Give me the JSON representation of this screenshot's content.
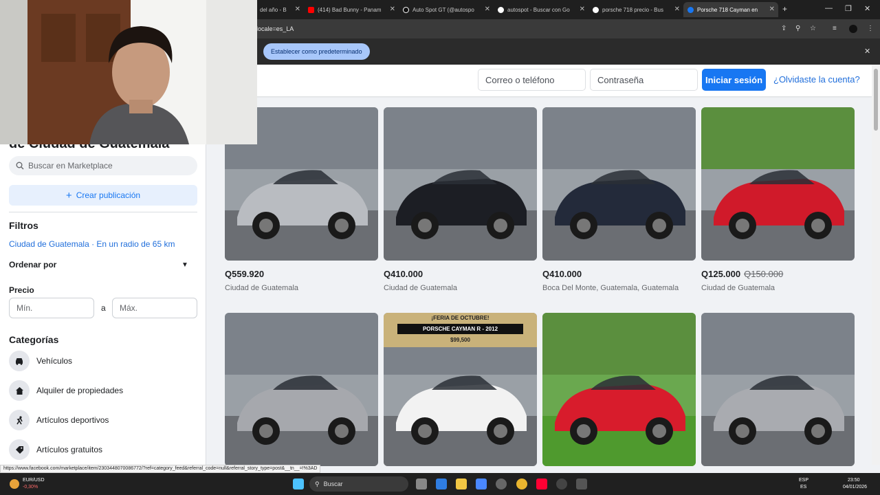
{
  "browser": {
    "tabs": [
      {
        "title": "del año - B"
      },
      {
        "title": "(414) Bad Bunny - Panam"
      },
      {
        "title": "Auto Spot GT (@autospo"
      },
      {
        "title": "autospot - Buscar con Go"
      },
      {
        "title": "porsche 718 precio - Bus"
      },
      {
        "title": "Porsche 718 Cayman en"
      }
    ],
    "url": "locale=es_LA",
    "default_button": "Establecer como predeterminado"
  },
  "login": {
    "email_placeholder": "Correo o teléfono",
    "password_placeholder": "Contraseña",
    "login_button": "Iniciar sesión",
    "forgot_link": "¿Olvidaste la cuenta?"
  },
  "sidebar": {
    "title": "de Ciudad de Guatemala",
    "search_placeholder": "Buscar en Marketplace",
    "create_label": "Crear publicación",
    "filters_label": "Filtros",
    "location": "Ciudad de Guatemala · En un radio de 65 km",
    "sort_label": "Ordenar por",
    "price_label": "Precio",
    "min_placeholder": "Mín.",
    "max_placeholder": "Máx.",
    "price_sep": "a",
    "categories_label": "Categorías",
    "categories": [
      {
        "label": "Vehículos",
        "icon": "car-icon"
      },
      {
        "label": "Alquiler de propiedades",
        "icon": "house-icon"
      },
      {
        "label": "Artículos deportivos",
        "icon": "sport-icon"
      },
      {
        "label": "Artículos gratuitos",
        "icon": "tag-icon"
      }
    ]
  },
  "listings": [
    {
      "price": "Q559.920",
      "old_price": "",
      "location": "Ciudad de Guatemala",
      "car_color": "#b9bcc1"
    },
    {
      "price": "Q410.000",
      "old_price": "",
      "location": "Ciudad de Guatemala",
      "car_color": "#1c1e24"
    },
    {
      "price": "Q410.000",
      "old_price": "",
      "location": "Boca Del Monte, Guatemala, Guatemala",
      "car_color": "#232a3a"
    },
    {
      "price": "Q125.000",
      "old_price": "Q150.000",
      "location": "Ciudad de Guatemala",
      "car_color": "#d01a2a"
    },
    {
      "car_color": "#a6a8ad"
    },
    {
      "car_color": "#f2f2f2",
      "banner": "¡FERIA DE OCTUBRE!",
      "banner2": "PORSCHE CAYMAN R - 2012",
      "banner3": "$99,500"
    },
    {
      "car_color": "#d81c2c"
    },
    {
      "car_color": "#a9abb0"
    }
  ],
  "status_url": "https://www.facebook.com/marketplace/item/2303448070086772/?ref=category_feed&referral_code=null&referral_story_type=post&__tn__=!%3AD",
  "taskbar": {
    "ticker": "EUR/USD",
    "ticker_change": "-0,30%",
    "search_label": "Buscar",
    "lang": "ESP",
    "lang2": "ES",
    "time": "23:50",
    "date": "04/01/2026"
  }
}
